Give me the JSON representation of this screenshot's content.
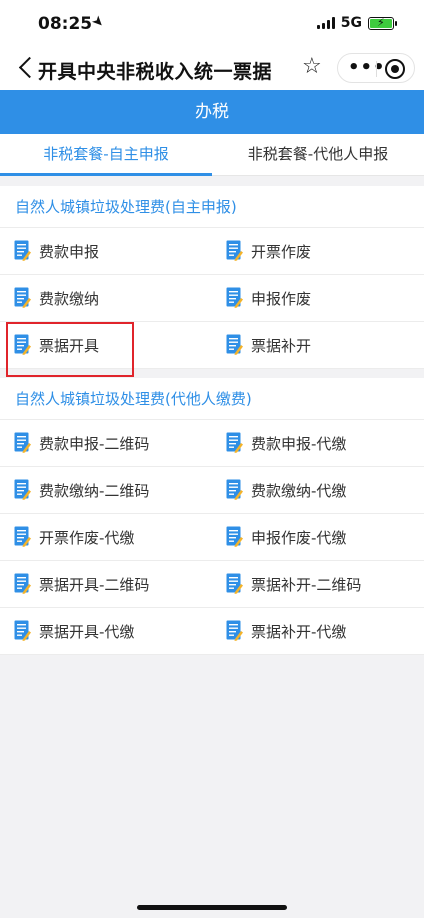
{
  "status": {
    "time": "08:25",
    "network": "5G"
  },
  "nav": {
    "title": "开具中央非税收入统一票据"
  },
  "header": {
    "title": "办税"
  },
  "tabs": [
    {
      "label": "非税套餐-自主申报",
      "active": true
    },
    {
      "label": "非税套餐-代他人申报",
      "active": false
    }
  ],
  "sections": [
    {
      "title": "自然人城镇垃圾处理费(自主申报)",
      "rows": [
        [
          "费款申报",
          "开票作废"
        ],
        [
          "费款缴纳",
          "申报作废"
        ],
        [
          "票据开具",
          "票据补开"
        ]
      ]
    },
    {
      "title": "自然人城镇垃圾处理费(代他人缴费)",
      "rows": [
        [
          "费款申报-二维码",
          "费款申报-代缴"
        ],
        [
          "费款缴纳-二维码",
          "费款缴纳-代缴"
        ],
        [
          "开票作废-代缴",
          "申报作废-代缴"
        ],
        [
          "票据开具-二维码",
          "票据补开-二维码"
        ],
        [
          "票据开具-代缴",
          "票据补开-代缴"
        ]
      ]
    }
  ],
  "colors": {
    "accent": "#2f8fe6",
    "highlight": "#e0242b",
    "icon_blue": "#2f8fe6",
    "icon_pencil": "#f3b32b"
  },
  "icons": {
    "item": "document-pencil-icon"
  }
}
